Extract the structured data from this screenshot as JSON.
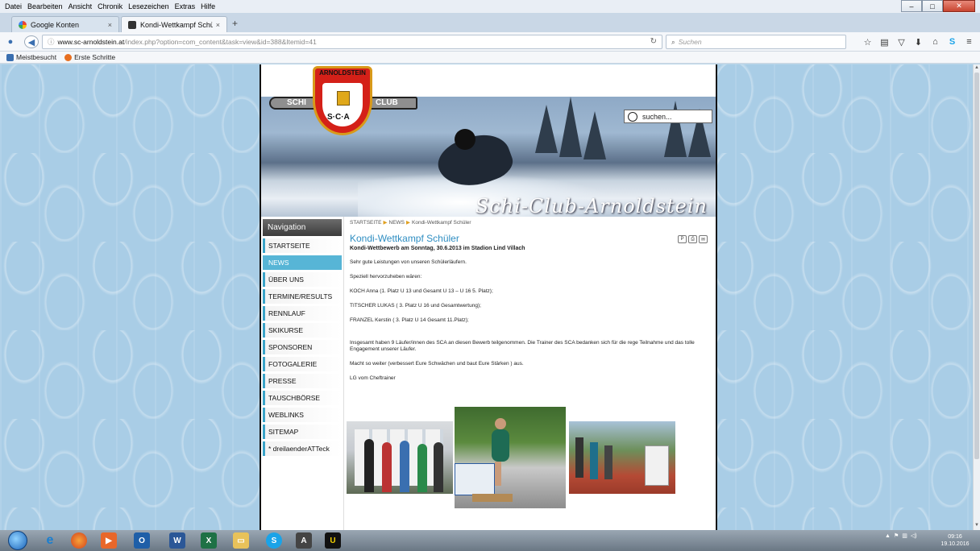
{
  "menubar": {
    "items": [
      "Datei",
      "Bearbeiten",
      "Ansicht",
      "Chronik",
      "Lesezeichen",
      "Extras",
      "Hilfe"
    ]
  },
  "tabs": [
    {
      "label": "Google Konten",
      "close": "×"
    },
    {
      "label": "Kondi-Wettkampf Schüler ...",
      "close": "×"
    }
  ],
  "newtab": "+",
  "urlbar": {
    "host": "www.sc-arnoldstein.at",
    "path": "/index.php?option=com_content&task=view&id=388&Itemid=41",
    "search_placeholder": "Suchen"
  },
  "bookmarks": [
    "Meistbesucht",
    "Erste Schritte"
  ],
  "site": {
    "logo_top": "ARNOLDSTEIN",
    "logo_left": "SCHI",
    "logo_right": "CLUB",
    "logo_bottom": "S·C·A",
    "name": "Schi-Club-Arnoldstein",
    "search_placeholder": "suchen..."
  },
  "nav": {
    "title": "Navigation",
    "items": [
      {
        "label": "STARTSEITE"
      },
      {
        "label": "NEWS"
      },
      {
        "label": "ÜBER UNS"
      },
      {
        "label": "TERMINE/RESULTS"
      },
      {
        "label": "RENNLAUF"
      },
      {
        "label": "SKIKURSE"
      },
      {
        "label": "SPONSOREN"
      },
      {
        "label": "FOTOGALERIE"
      },
      {
        "label": "PRESSE"
      },
      {
        "label": "TAUSCHBÖRSE"
      },
      {
        "label": "WEBLINKS"
      },
      {
        "label": "SITEMAP"
      },
      {
        "label": "* dreilaenderATTeck"
      }
    ]
  },
  "article": {
    "breadcrumb": [
      "STARTSEITE",
      "NEWS",
      "Kondi-Wettkampf Schüler"
    ],
    "title": "Kondi-Wettkampf Schüler",
    "subtitle": "Kondi-Wettbewerb am  Sonntag, 30.6.2013 im Stadion Lind Villach",
    "paragraphs": [
      "Sehr gute Leistungen von unseren Schülerläufern.",
      " Speziell hervorzuheben wären:",
      " KOCH Anna (1. Platz U 13  und Gesamt U 13 – U 16  5. Platz);",
      "TITSCHER LUKAS ( 3. Platz U 16 und Gesamtwertung);",
      "FRANZEL Kerstin  ( 3. Platz U 14 Gesamt  11.Platz);",
      "Insgesamt haben 9 Läufer/innen des SCA an diesen Bewerb teilgenommen. Die Trainer des SCA bedanken sich für die rege Teilnahme und das tolle Engagement unserer Läufer.",
      "Macht so weiter (verbessert Eure Schwächen und baut Eure Stärken ) aus.",
      "LG vom Cheftrainer"
    ]
  },
  "taskbar": {
    "time": "09:16",
    "date": "19.10.2016"
  },
  "colors": {
    "link_blue": "#2f8ec2",
    "nav_active": "#57b5d6",
    "nav_accent": "#3aa3c8",
    "page_bg": "#a9cde6"
  }
}
